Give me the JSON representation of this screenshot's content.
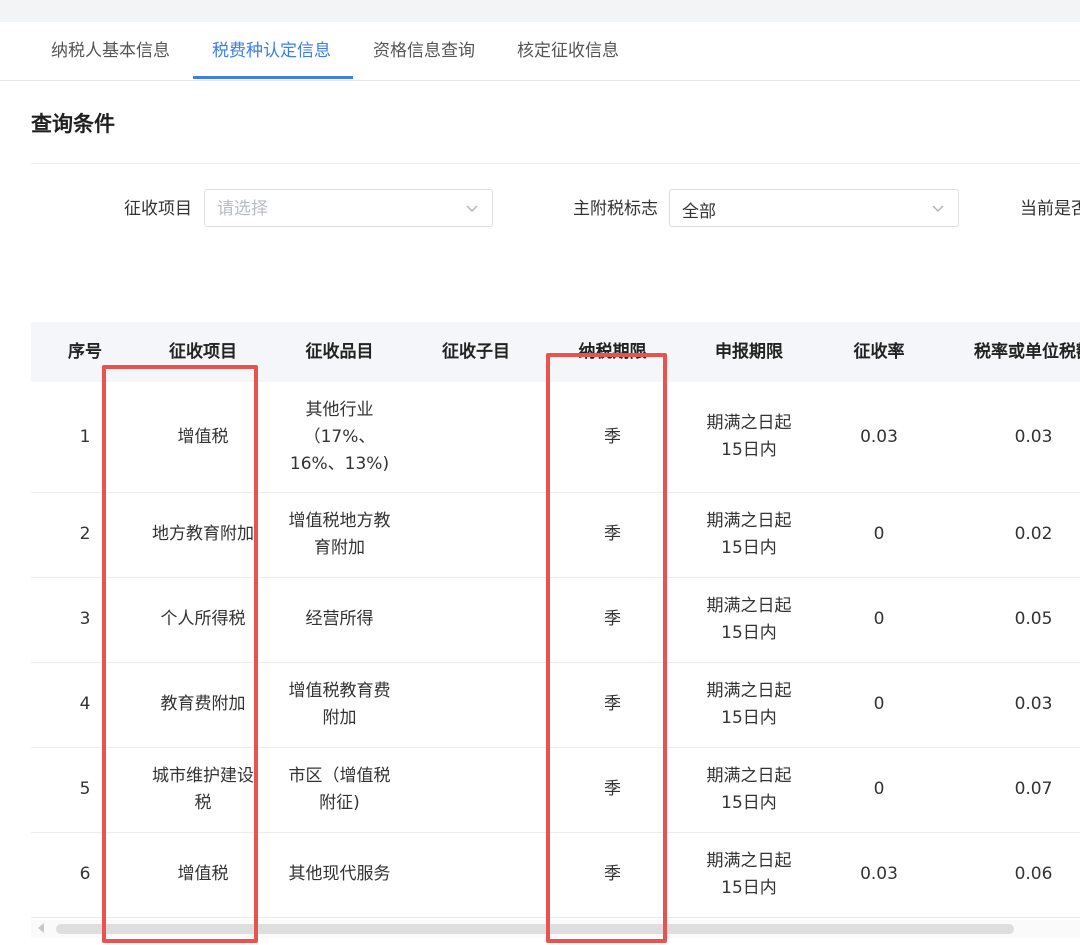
{
  "tabs": [
    {
      "label": "纳税人基本信息",
      "active": false
    },
    {
      "label": "税费种认定信息",
      "active": true
    },
    {
      "label": "资格信息查询",
      "active": false
    },
    {
      "label": "核定征收信息",
      "active": false
    }
  ],
  "section_title": "查询条件",
  "filters": {
    "levy_item_label": "征收项目",
    "levy_item_placeholder": "请选择",
    "tax_flag_label": "主附税标志",
    "tax_flag_value": "全部",
    "current_label": "当前是否"
  },
  "table": {
    "headers": [
      "序号",
      "征收项目",
      "征收品目",
      "征收子目",
      "纳税期限",
      "申报期限",
      "征收率",
      "税率或单位税额"
    ],
    "rows": [
      {
        "index": "1",
        "item": [
          "增值税"
        ],
        "category": [
          "其他行业",
          "（17%、",
          "16%、13%)"
        ],
        "subitem": "",
        "period": "季",
        "deadline": [
          "期满之日起",
          "15日内"
        ],
        "levy_rate": "0.03",
        "tax_rate": "0.03"
      },
      {
        "index": "2",
        "item": [
          "地方教育附加"
        ],
        "category": [
          "增值税地方教",
          "育附加"
        ],
        "subitem": "",
        "period": "季",
        "deadline": [
          "期满之日起",
          "15日内"
        ],
        "levy_rate": "0",
        "tax_rate": "0.02"
      },
      {
        "index": "3",
        "item": [
          "个人所得税"
        ],
        "category": [
          "经营所得"
        ],
        "subitem": "",
        "period": "季",
        "deadline": [
          "期满之日起",
          "15日内"
        ],
        "levy_rate": "0",
        "tax_rate": "0.05"
      },
      {
        "index": "4",
        "item": [
          "教育费附加"
        ],
        "category": [
          "增值税教育费",
          "附加"
        ],
        "subitem": "",
        "period": "季",
        "deadline": [
          "期满之日起",
          "15日内"
        ],
        "levy_rate": "0",
        "tax_rate": "0.03"
      },
      {
        "index": "5",
        "item": [
          "城市维护建设",
          "税"
        ],
        "category": [
          "市区（增值税",
          "附征)"
        ],
        "subitem": "",
        "period": "季",
        "deadline": [
          "期满之日起",
          "15日内"
        ],
        "levy_rate": "0",
        "tax_rate": "0.07"
      },
      {
        "index": "6",
        "item": [
          "增值税"
        ],
        "category": [
          "其他现代服务"
        ],
        "subitem": "",
        "period": "季",
        "deadline": [
          "期满之日起",
          "15日内"
        ],
        "levy_rate": "0.03",
        "tax_rate": "0.06"
      }
    ]
  },
  "colors": {
    "accent": "#3d7ee8",
    "highlight": "#e8534f"
  },
  "icons": {
    "select_arrow": "chevron-down-icon",
    "scroll_left": "scroll-left-arrow-icon"
  }
}
